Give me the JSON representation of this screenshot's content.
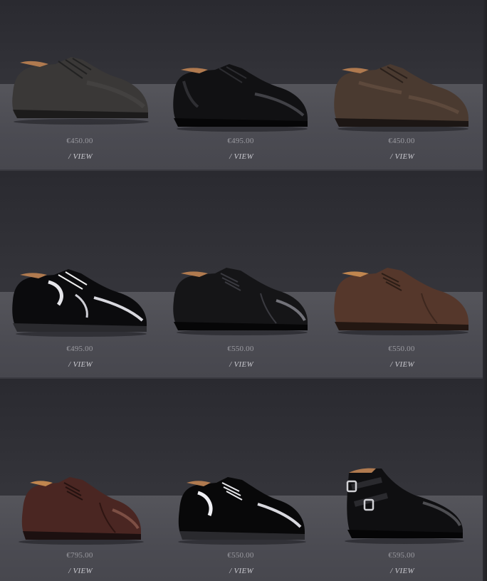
{
  "products": [
    {
      "price": "€450.00",
      "link": "/ VIEW",
      "style": "derby-suede-grey",
      "color": "#3a3837"
    },
    {
      "price": "€495.00",
      "link": "/ VIEW",
      "style": "derby-black-calf",
      "color": "#111113"
    },
    {
      "price": "€450.00",
      "link": "/ VIEW",
      "style": "derby-brown-washed",
      "color": "#4a3a30"
    },
    {
      "price": "€495.00",
      "link": "/ VIEW",
      "style": "derby-black-patent",
      "color": "#0b0b0d"
    },
    {
      "price": "€550.00",
      "link": "/ VIEW",
      "style": "oxford-black-captoe",
      "color": "#151517"
    },
    {
      "price": "€550.00",
      "link": "/ VIEW",
      "style": "oxford-brown-suede",
      "color": "#55372b"
    },
    {
      "price": "€795.00",
      "link": "/ VIEW",
      "style": "oxford-burgundy",
      "color": "#4a2622"
    },
    {
      "price": "€550.00",
      "link": "/ VIEW",
      "style": "oxford-black-patent",
      "color": "#080809"
    },
    {
      "price": "€595.00",
      "link": "/ VIEW",
      "style": "double-monk-black",
      "color": "#0f0f11"
    }
  ]
}
